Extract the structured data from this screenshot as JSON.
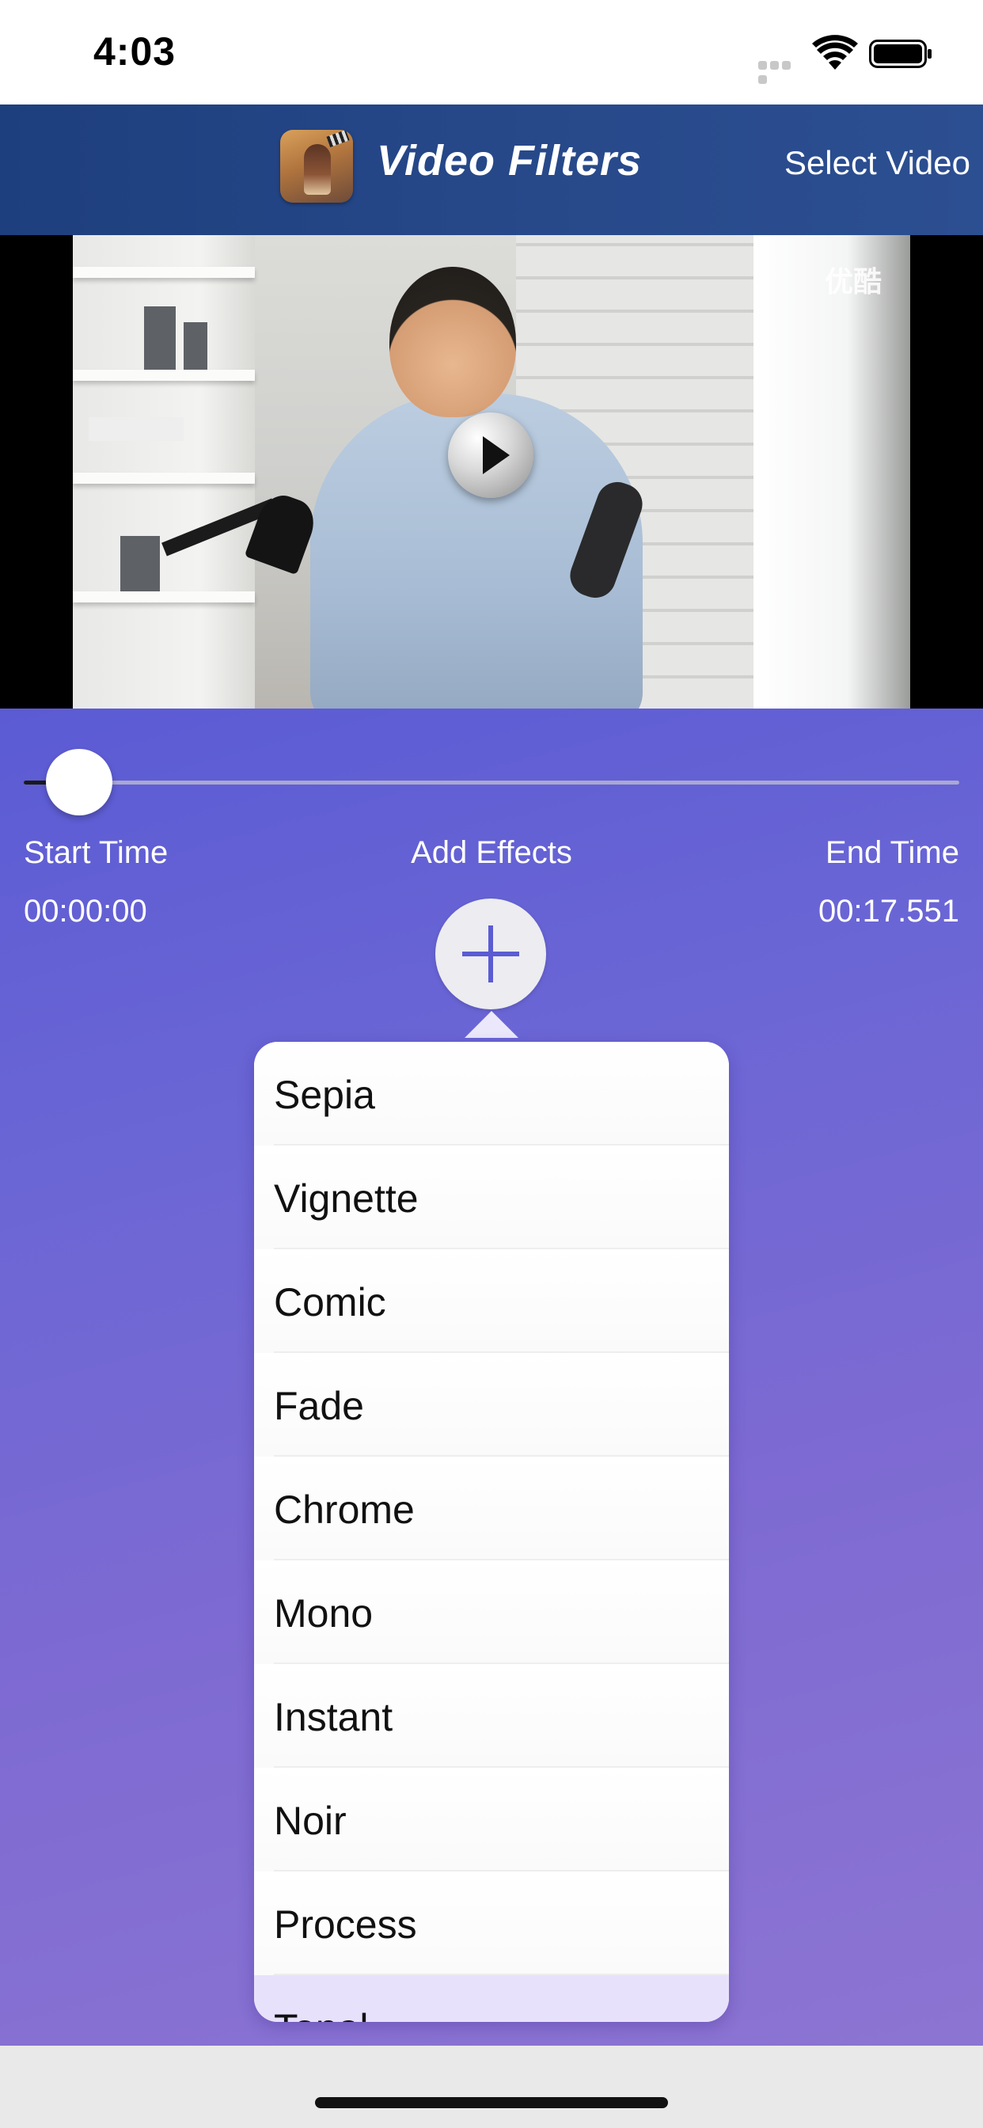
{
  "status_bar": {
    "time": "4:03"
  },
  "nav": {
    "title": "Video Filters",
    "select_video_label": "Select Video"
  },
  "video": {
    "watermark": "优酷"
  },
  "trim": {
    "start_label": "Start Time",
    "start_value": "00:00:00",
    "effects_label": "Add Effects",
    "end_label": "End Time",
    "end_value": "00:17.551",
    "slider_position_fraction": 0
  },
  "effects_menu": {
    "items": [
      {
        "label": "Sepia"
      },
      {
        "label": "Vignette"
      },
      {
        "label": "Comic"
      },
      {
        "label": "Fade"
      },
      {
        "label": "Chrome"
      },
      {
        "label": "Mono"
      },
      {
        "label": "Instant"
      },
      {
        "label": "Noir"
      },
      {
        "label": "Process"
      },
      {
        "label": "Tonal"
      }
    ]
  },
  "colors": {
    "nav_bar": "#27498a",
    "panel_start": "#5b5bd4",
    "panel_end": "#8c74d2",
    "menu_highlight": "#e8e1fb"
  },
  "icons": {
    "play": "play-icon",
    "add": "plus-icon",
    "wifi": "wifi-icon",
    "battery": "battery-icon",
    "signal": "signal-icon"
  }
}
